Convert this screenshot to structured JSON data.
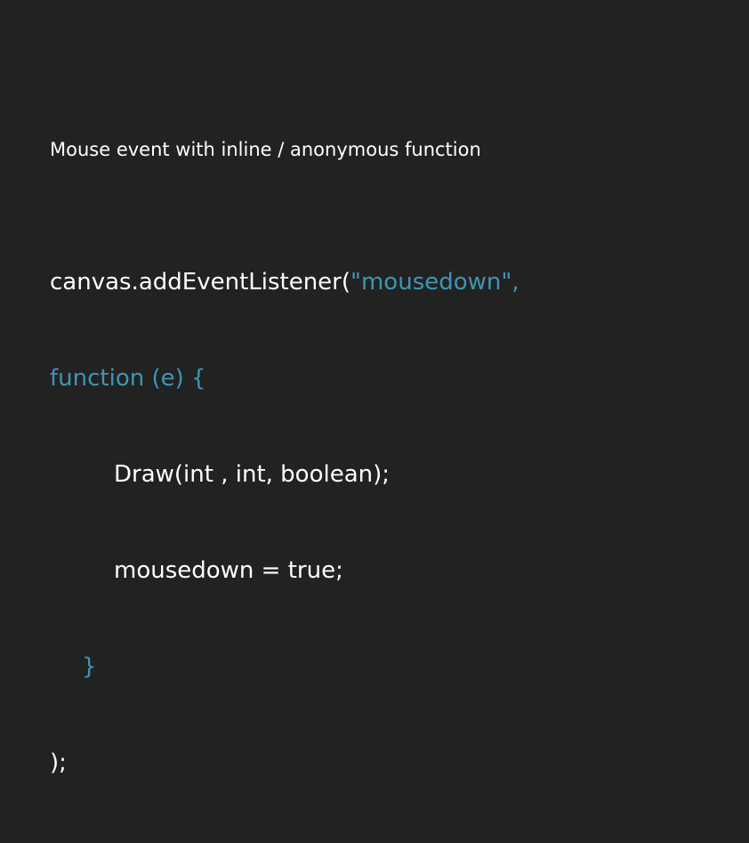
{
  "heading": "Mouse event with inline / anonymous function",
  "code": {
    "line1_object": "canvas.addEventListener(",
    "line1_string": "\"mousedown\",",
    "line2": "function (e) {",
    "line3": "Draw(int , int, boolean);",
    "line4": "mousedown = true;",
    "line5": "}",
    "line6": ");"
  },
  "colors": {
    "background": "#222222",
    "text": "#ffffff",
    "accent": "#3d96b4"
  }
}
